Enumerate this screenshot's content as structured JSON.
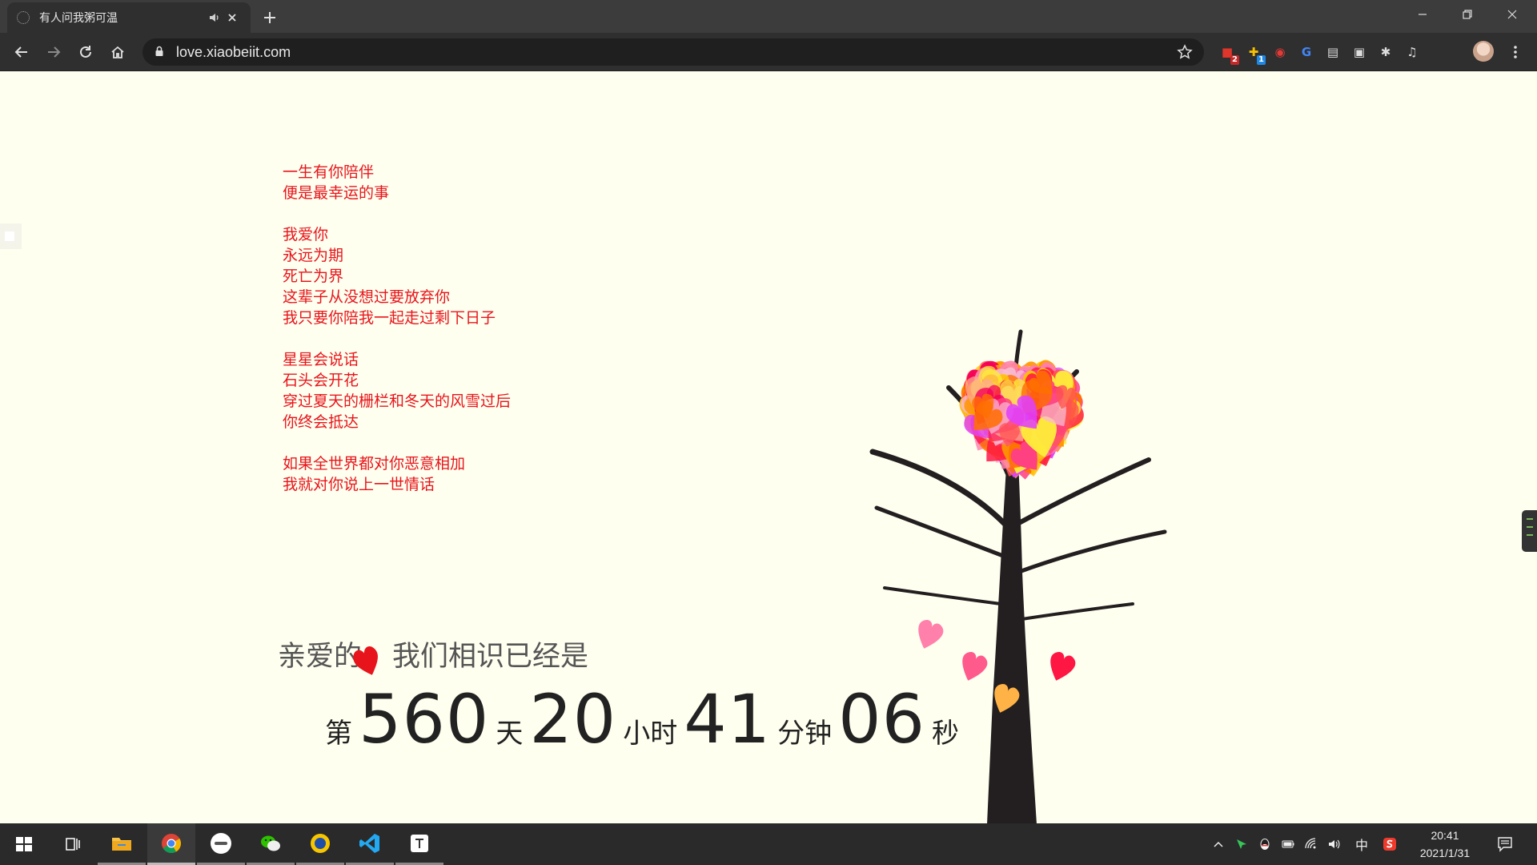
{
  "browser": {
    "tab_title": "有人问我粥可温",
    "url": "love.xiaobeiit.com",
    "extensions": [
      {
        "name": "ext-red-icon",
        "glyph": "■",
        "color": "#e0352b",
        "badge": "2",
        "badge_color": "#c62828"
      },
      {
        "name": "ext-yellow-icon",
        "glyph": "✚",
        "color": "#f5c000",
        "badge": "1",
        "badge_color": "#1e88e5"
      },
      {
        "name": "ext-red-swirl-icon",
        "glyph": "◉",
        "color": "#e53935",
        "badge": "",
        "badge_color": ""
      },
      {
        "name": "ext-translate-icon",
        "glyph": "G",
        "color": "#4285f4",
        "badge": "",
        "badge_color": ""
      },
      {
        "name": "ext-reader-icon",
        "glyph": "▤",
        "color": "#dddddd",
        "badge": "",
        "badge_color": ""
      },
      {
        "name": "ext-square-icon",
        "glyph": "▣",
        "color": "#dddddd",
        "badge": "",
        "badge_color": ""
      },
      {
        "name": "extensions-puzzle-icon",
        "glyph": "✱",
        "color": "#dddddd",
        "badge": "",
        "badge_color": ""
      },
      {
        "name": "media-control-icon",
        "glyph": "♫",
        "color": "#dddddd",
        "badge": "",
        "badge_color": ""
      }
    ]
  },
  "poem": {
    "stanzas": [
      [
        "一生有你陪伴",
        "便是最幸运的事"
      ],
      [
        "我爱你",
        "永远为期",
        "死亡为界",
        "这辈子从没想过要放弃你",
        "我只要你陪我一起走过剩下日子"
      ],
      [
        "星星会说话",
        "石头会开花",
        "穿过夏天的栅栏和冬天的风雪过后",
        "你终会抵达"
      ],
      [
        "如果全世界都对你恶意相加",
        "我就对你说上一世情话"
      ]
    ]
  },
  "counter": {
    "heading_left": "亲爱的",
    "heading_right": "我们相识已经是",
    "prefix": "第",
    "days": "560",
    "days_unit": "天",
    "hours": "20",
    "hours_unit": "小时",
    "minutes": "41",
    "minutes_unit": "分钟",
    "seconds": "06",
    "seconds_unit": "秒"
  },
  "colors": {
    "poem_text": "#e8141b",
    "page_background": "#fffff0",
    "heart_palette": [
      "#ff1744",
      "#ff4081",
      "#ff80ab",
      "#f50057",
      "#ff9800",
      "#ffc107",
      "#ffeb3b",
      "#e040fb",
      "#ff5252",
      "#ffab91",
      "#f8bbd0",
      "#ff6f00"
    ]
  },
  "taskbar": {
    "apps": [
      {
        "name": "start-button-icon"
      },
      {
        "name": "task-view-icon"
      },
      {
        "name": "file-explorer-icon"
      },
      {
        "name": "chrome-icon"
      },
      {
        "name": "app-round-icon"
      },
      {
        "name": "wechat-icon"
      },
      {
        "name": "app-yellow-icon"
      },
      {
        "name": "vscode-icon"
      },
      {
        "name": "typora-icon"
      }
    ],
    "tray_ime": "中",
    "clock_time": "20:41",
    "clock_date": "2021/1/31"
  }
}
